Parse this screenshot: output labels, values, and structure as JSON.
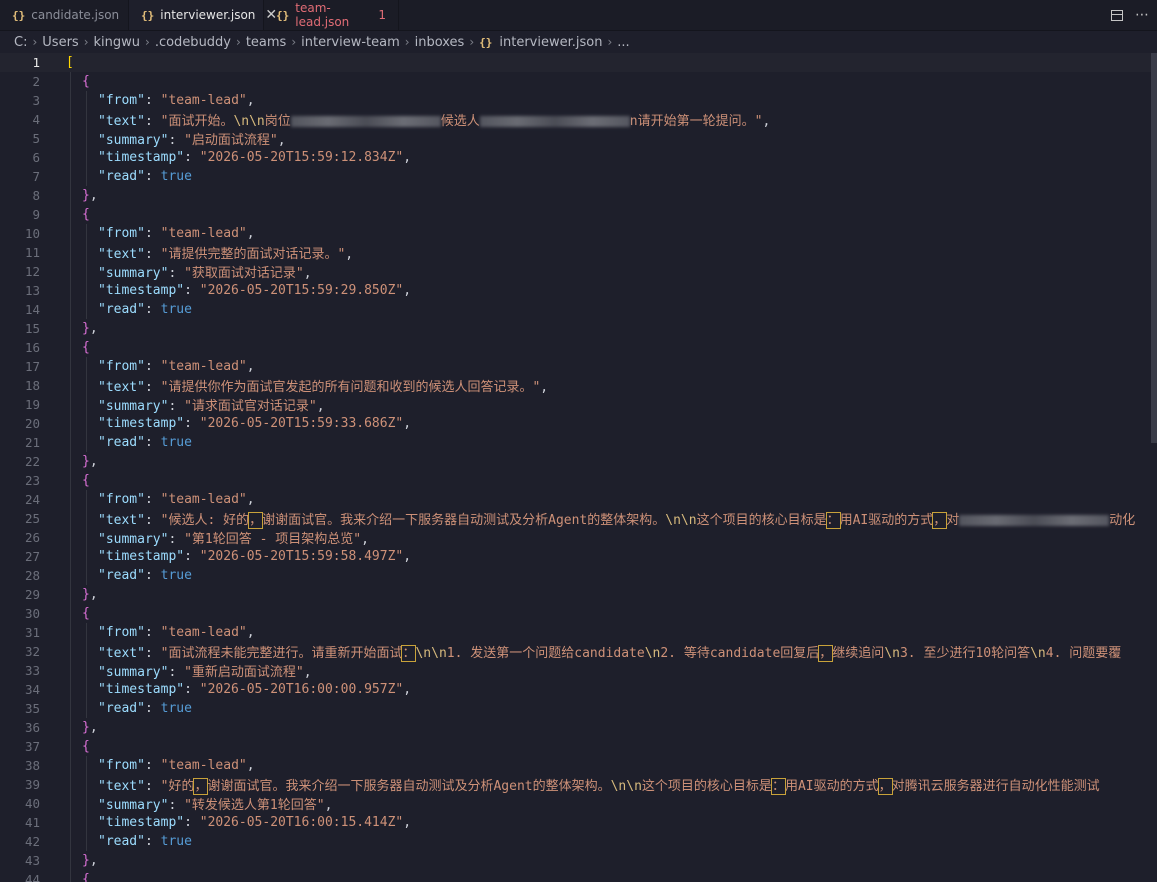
{
  "tabs": [
    {
      "label": "candidate.json",
      "active": false
    },
    {
      "label": "interviewer.json",
      "active": true
    },
    {
      "label": "team-lead.json",
      "badge": "1",
      "active": false
    }
  ],
  "breadcrumb": [
    "C:",
    "Users",
    "kingwu",
    ".codebuddy",
    "teams",
    "interview-team",
    "inboxes",
    "interviewer.json",
    "..."
  ],
  "editor": {
    "current_line": 1,
    "lines": [
      {
        "n": 1,
        "t": "["
      },
      {
        "n": 2,
        "t": "{"
      },
      {
        "n": 3,
        "t": "\"from\": \"team-lead\","
      },
      {
        "n": 4,
        "t": "\"text\": \"面试开始。\\n\\n岗位[REDACTED]候选人[REDACTED]n请开始第一轮提问。\","
      },
      {
        "n": 5,
        "t": "\"summary\": \"启动面试流程\","
      },
      {
        "n": 6,
        "t": "\"timestamp\": \"2026-05-20T15:59:12.834Z\","
      },
      {
        "n": 7,
        "t": "\"read\": true"
      },
      {
        "n": 8,
        "t": "},"
      },
      {
        "n": 9,
        "t": "{"
      },
      {
        "n": 10,
        "t": "\"from\": \"team-lead\","
      },
      {
        "n": 11,
        "t": "\"text\": \"请提供完整的面试对话记录。\","
      },
      {
        "n": 12,
        "t": "\"summary\": \"获取面试对话记录\","
      },
      {
        "n": 13,
        "t": "\"timestamp\": \"2026-05-20T15:59:29.850Z\","
      },
      {
        "n": 14,
        "t": "\"read\": true"
      },
      {
        "n": 15,
        "t": "},"
      },
      {
        "n": 16,
        "t": "{"
      },
      {
        "n": 17,
        "t": "\"from\": \"team-lead\","
      },
      {
        "n": 18,
        "t": "\"text\": \"请提供你作为面试官发起的所有问题和收到的候选人回答记录。\","
      },
      {
        "n": 19,
        "t": "\"summary\": \"请求面试官对话记录\","
      },
      {
        "n": 20,
        "t": "\"timestamp\": \"2026-05-20T15:59:33.686Z\","
      },
      {
        "n": 21,
        "t": "\"read\": true"
      },
      {
        "n": 22,
        "t": "},"
      },
      {
        "n": 23,
        "t": "{"
      },
      {
        "n": 24,
        "t": "\"from\": \"team-lead\","
      },
      {
        "n": 25,
        "t": "\"text\": \"候选人: 好的，谢谢面试官。我来介绍一下服务器自动测试及分析Agent的整体架构。\\n\\n这个项目的核心目标是：用AI驱动的方式，对[REDACTED]动化"
      },
      {
        "n": 26,
        "t": "\"summary\": \"第1轮回答 - 项目架构总览\","
      },
      {
        "n": 27,
        "t": "\"timestamp\": \"2026-05-20T15:59:58.497Z\","
      },
      {
        "n": 28,
        "t": "\"read\": true"
      },
      {
        "n": 29,
        "t": "},"
      },
      {
        "n": 30,
        "t": "{"
      },
      {
        "n": 31,
        "t": "\"from\": \"team-lead\","
      },
      {
        "n": 32,
        "t": "\"text\": \"面试流程未能完整进行。请重新开始面试：\\n\\n1. 发送第一个问题给candidate\\n2. 等待candidate回复后，继续追问\\n3. 至少进行10轮问答\\n4. 问题要覆"
      },
      {
        "n": 33,
        "t": "\"summary\": \"重新启动面试流程\","
      },
      {
        "n": 34,
        "t": "\"timestamp\": \"2026-05-20T16:00:00.957Z\","
      },
      {
        "n": 35,
        "t": "\"read\": true"
      },
      {
        "n": 36,
        "t": "},"
      },
      {
        "n": 37,
        "t": "{"
      },
      {
        "n": 38,
        "t": "\"from\": \"team-lead\","
      },
      {
        "n": 39,
        "t": "\"text\": \"好的，谢谢面试官。我来介绍一下服务器自动测试及分析Agent的整体架构。\\n\\n这个项目的核心目标是：用AI驱动的方式，对腾讯云服务器进行自动化性能测试"
      },
      {
        "n": 40,
        "t": "\"summary\": \"转发候选人第1轮回答\","
      },
      {
        "n": 41,
        "t": "\"timestamp\": \"2026-05-20T16:00:15.414Z\","
      },
      {
        "n": 42,
        "t": "\"read\": true"
      },
      {
        "n": 43,
        "t": "},"
      },
      {
        "n": 44,
        "t": "{"
      }
    ]
  }
}
